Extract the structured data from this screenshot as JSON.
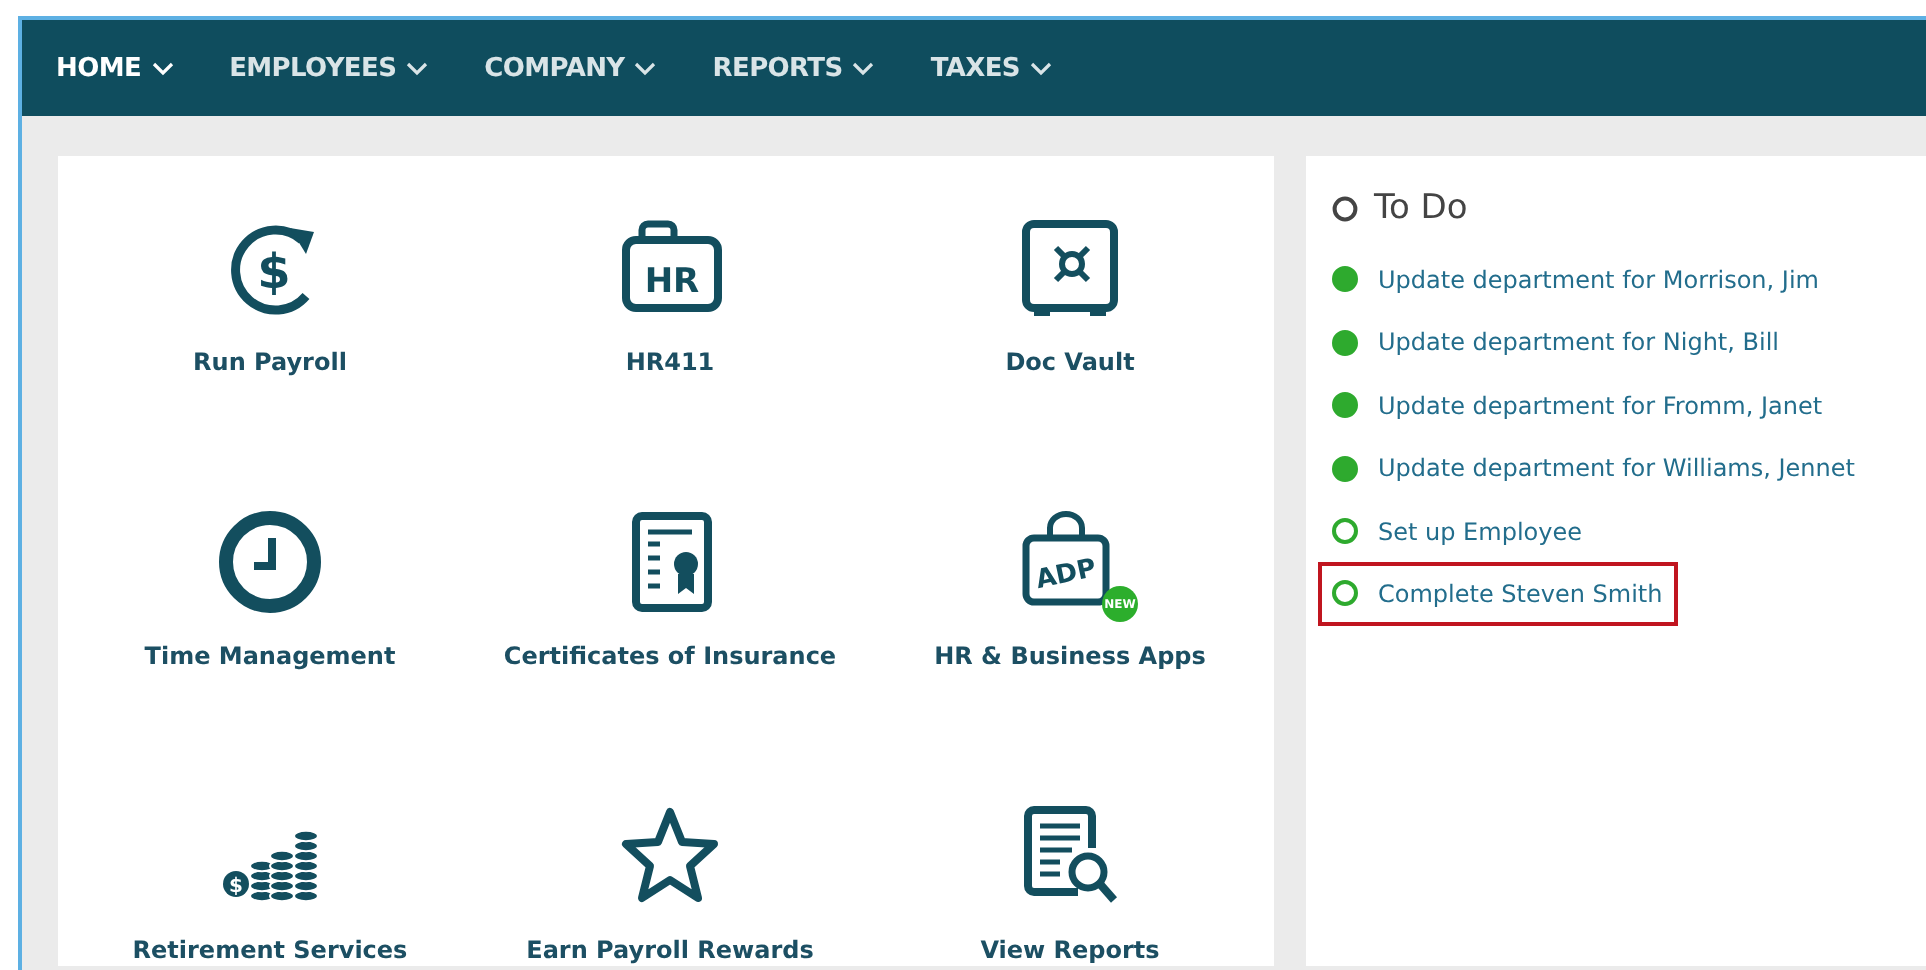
{
  "nav": {
    "items": [
      {
        "label": "HOME",
        "selected": true
      },
      {
        "label": "EMPLOYEES",
        "selected": false
      },
      {
        "label": "COMPANY",
        "selected": false
      },
      {
        "label": "REPORTS",
        "selected": false
      },
      {
        "label": "TAXES",
        "selected": false
      }
    ]
  },
  "tiles": [
    {
      "label": "Run Payroll",
      "icon_text": "$"
    },
    {
      "label": "HR411",
      "icon_text": "HR"
    },
    {
      "label": "Doc Vault"
    },
    {
      "label": "Time Management"
    },
    {
      "label": "Certificates of Insurance"
    },
    {
      "label": "HR & Business Apps",
      "icon_text": "ADP",
      "badge": "NEW"
    },
    {
      "label": "Retirement Services",
      "icon_text": "$"
    },
    {
      "label": "Earn Payroll Rewards"
    },
    {
      "label": "View Reports"
    }
  ],
  "todo": {
    "title": "To Do",
    "items": [
      {
        "text": "Update department for Morrison, Jim",
        "done": true,
        "highlighted": false
      },
      {
        "text": "Update department for Night, Bill",
        "done": true,
        "highlighted": false
      },
      {
        "text": "Update department for Fromm, Janet",
        "done": true,
        "highlighted": false
      },
      {
        "text": "Update department for Williams, Jennet",
        "done": true,
        "highlighted": false
      },
      {
        "text": "Set up Employee",
        "done": false,
        "highlighted": false
      },
      {
        "text": "Complete Steven Smith",
        "done": false,
        "highlighted": true
      }
    ]
  }
}
